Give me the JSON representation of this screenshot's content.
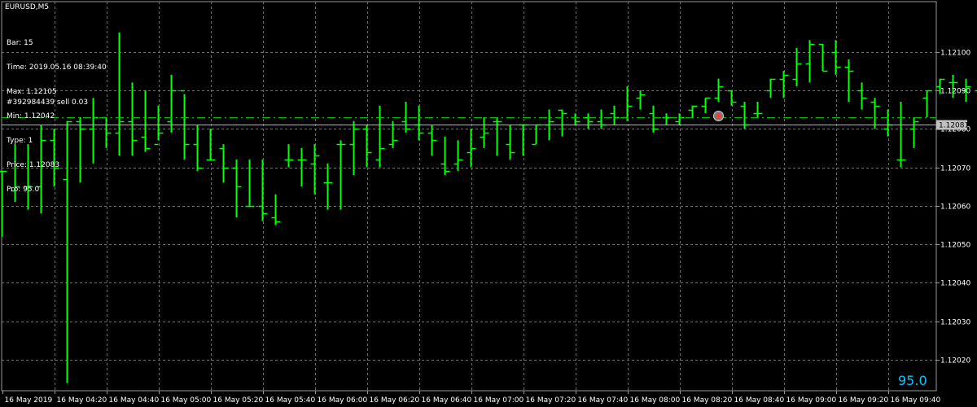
{
  "symbol_tf": "EURUSD,M5",
  "info_lines": [
    "Bar: 15",
    "Time: 2019.05.16 08:39:40",
    "Max: 1.12105",
    "Min: 1.12042",
    "Type: 1",
    "Price: 1.12083",
    "Pro: 95.0"
  ],
  "order_label": "#392984439 sell 0.03",
  "current_price_label": "1.12081",
  "big_value": "95.0",
  "colors": {
    "bars": "#00ff00",
    "grid": "#6f6f6f",
    "price_tag": "#c0c0c0",
    "big_value": "#00c8ff"
  },
  "chart_data": {
    "type": "ohlc",
    "xlabel": "",
    "ylabel": "",
    "ylim": [
      1.12012,
      1.12113
    ],
    "grid": true,
    "y_ticks": [
      "1.12100",
      "1.12090",
      "1.12080",
      "1.12070",
      "1.12060",
      "1.12050",
      "1.12040",
      "1.12030",
      "1.12020"
    ],
    "x_ticks": [
      "16 May 2019",
      "16 May 04:20",
      "16 May 04:40",
      "16 May 05:00",
      "16 May 05:20",
      "16 May 05:40",
      "16 May 06:00",
      "16 May 06:20",
      "16 May 06:40",
      "16 May 07:00",
      "16 May 07:20",
      "16 May 07:40",
      "16 May 08:00",
      "16 May 08:20",
      "16 May 08:40",
      "16 May 09:00",
      "16 May 09:20",
      "16 May 09:40"
    ],
    "order_price": 1.12083,
    "current_price": 1.12081,
    "bars": [
      {
        "h": 1.12069,
        "l": 1.12052,
        "o": 1.12069,
        "c": 1.12069
      },
      {
        "h": 1.12076,
        "l": 1.12061,
        "o": 1.12064,
        "c": 1.12065
      },
      {
        "h": 1.12076,
        "l": 1.12059,
        "o": 1.12065,
        "c": 1.12065
      },
      {
        "h": 1.12081,
        "l": 1.12058,
        "o": 1.12065,
        "c": 1.12077
      },
      {
        "h": 1.1208,
        "l": 1.12065,
        "o": 1.12077,
        "c": 1.1207
      },
      {
        "h": 1.12082,
        "l": 1.12014,
        "o": 1.12067,
        "c": 1.12082
      },
      {
        "h": 1.12083,
        "l": 1.12066,
        "o": 1.12082,
        "c": 1.1208
      },
      {
        "h": 1.12088,
        "l": 1.12071,
        "o": 1.1208,
        "c": 1.12083
      },
      {
        "h": 1.12083,
        "l": 1.12075,
        "o": 1.12083,
        "c": 1.12079
      },
      {
        "h": 1.12105,
        "l": 1.12073,
        "o": 1.12079,
        "c": 1.12082
      },
      {
        "h": 1.12092,
        "l": 1.12073,
        "o": 1.12082,
        "c": 1.12077
      },
      {
        "h": 1.1209,
        "l": 1.12074,
        "o": 1.12078,
        "c": 1.12075
      },
      {
        "h": 1.12086,
        "l": 1.12077,
        "o": 1.12076,
        "c": 1.12079
      },
      {
        "h": 1.12094,
        "l": 1.12079,
        "o": 1.12082,
        "c": 1.1209
      },
      {
        "h": 1.12089,
        "l": 1.12072,
        "o": 1.1209,
        "c": 1.12076
      },
      {
        "h": 1.12081,
        "l": 1.12069,
        "o": 1.12076,
        "c": 1.1207
      },
      {
        "h": 1.1208,
        "l": 1.12072,
        "o": 1.12072,
        "c": 1.12072
      },
      {
        "h": 1.12076,
        "l": 1.12066,
        "o": 1.12075,
        "c": 1.1207
      },
      {
        "h": 1.12072,
        "l": 1.12057,
        "o": 1.1207,
        "c": 1.12065
      },
      {
        "h": 1.12072,
        "l": 1.1206,
        "o": 1.1206,
        "c": 1.1206
      },
      {
        "h": 1.12072,
        "l": 1.12056,
        "o": 1.1206,
        "c": 1.12058
      },
      {
        "h": 1.12063,
        "l": 1.12055,
        "o": 1.12057,
        "c": 1.12056
      },
      {
        "h": 1.12076,
        "l": 1.1207,
        "o": 1.12072,
        "c": 1.12072
      },
      {
        "h": 1.12075,
        "l": 1.12065,
        "o": 1.12072,
        "c": 1.12072
      },
      {
        "h": 1.12076,
        "l": 1.12063,
        "o": 1.12071,
        "c": 1.12073
      },
      {
        "h": 1.12071,
        "l": 1.12059,
        "o": 1.12066,
        "c": 1.12066
      },
      {
        "h": 1.12077,
        "l": 1.12059,
        "o": 1.12076,
        "c": 1.12076
      },
      {
        "h": 1.12082,
        "l": 1.12068,
        "o": 1.12076,
        "c": 1.1208
      },
      {
        "h": 1.12081,
        "l": 1.1207,
        "o": 1.1208,
        "c": 1.12074
      },
      {
        "h": 1.12086,
        "l": 1.1207,
        "o": 1.12072,
        "c": 1.12075
      },
      {
        "h": 1.12082,
        "l": 1.12075,
        "o": 1.12076,
        "c": 1.12077
      },
      {
        "h": 1.12087,
        "l": 1.12079,
        "o": 1.12082,
        "c": 1.1208
      },
      {
        "h": 1.12086,
        "l": 1.12077,
        "o": 1.12081,
        "c": 1.12079
      },
      {
        "h": 1.12081,
        "l": 1.12073,
        "o": 1.12079,
        "c": 1.12077
      },
      {
        "h": 1.12078,
        "l": 1.12068,
        "o": 1.12071,
        "c": 1.12069
      },
      {
        "h": 1.12077,
        "l": 1.12069,
        "o": 1.12071,
        "c": 1.12072
      },
      {
        "h": 1.1208,
        "l": 1.1207,
        "o": 1.12074,
        "c": 1.12075
      },
      {
        "h": 1.12083,
        "l": 1.12075,
        "o": 1.12078,
        "c": 1.12079
      },
      {
        "h": 1.12083,
        "l": 1.12073,
        "o": 1.12082,
        "c": 1.12082
      },
      {
        "h": 1.12081,
        "l": 1.12072,
        "o": 1.12076,
        "c": 1.12074
      },
      {
        "h": 1.12081,
        "l": 1.12073,
        "o": 1.12081,
        "c": 1.12081
      },
      {
        "h": 1.12081,
        "l": 1.12076,
        "o": 1.12076,
        "c": 1.12081
      },
      {
        "h": 1.12085,
        "l": 1.12077,
        "o": 1.12081,
        "c": 1.12082
      },
      {
        "h": 1.12085,
        "l": 1.12078,
        "o": 1.12085,
        "c": 1.12084
      },
      {
        "h": 1.12084,
        "l": 1.12081,
        "o": 1.12083,
        "c": 1.12082
      },
      {
        "h": 1.12084,
        "l": 1.1208,
        "o": 1.12083,
        "c": 1.12082
      },
      {
        "h": 1.12085,
        "l": 1.1208,
        "o": 1.12082,
        "c": 1.12081
      },
      {
        "h": 1.12086,
        "l": 1.12081,
        "o": 1.12084,
        "c": 1.12083
      },
      {
        "h": 1.12091,
        "l": 1.12082,
        "o": 1.12083,
        "c": 1.12086
      },
      {
        "h": 1.1209,
        "l": 1.12085,
        "o": 1.12088,
        "c": 1.12089
      },
      {
        "h": 1.12086,
        "l": 1.12079,
        "o": 1.12084,
        "c": 1.1208
      },
      {
        "h": 1.12084,
        "l": 1.12081,
        "o": 1.12083,
        "c": 1.12083
      },
      {
        "h": 1.12084,
        "l": 1.12081,
        "o": 1.12082,
        "c": 1.12083
      },
      {
        "h": 1.12086,
        "l": 1.12083,
        "o": 1.12085,
        "c": 1.12086
      },
      {
        "h": 1.12088,
        "l": 1.12084,
        "o": 1.12086,
        "c": 1.12088
      },
      {
        "h": 1.12093,
        "l": 1.12087,
        "o": 1.12088,
        "c": 1.12091
      },
      {
        "h": 1.1209,
        "l": 1.12086,
        "o": 1.1209,
        "c": 1.12087
      },
      {
        "h": 1.12087,
        "l": 1.1208,
        "o": 1.12086,
        "c": 1.12081
      },
      {
        "h": 1.12087,
        "l": 1.12083,
        "o": 1.12084,
        "c": 1.12084
      },
      {
        "h": 1.12093,
        "l": 1.12088,
        "o": 1.1209,
        "c": 1.12093
      },
      {
        "h": 1.12095,
        "l": 1.12088,
        "o": 1.12093,
        "c": 1.12094
      },
      {
        "h": 1.12101,
        "l": 1.12091,
        "o": 1.12093,
        "c": 1.12097
      },
      {
        "h": 1.12103,
        "l": 1.12092,
        "o": 1.12097,
        "c": 1.12102
      },
      {
        "h": 1.12102,
        "l": 1.12095,
        "o": 1.12102,
        "c": 1.12095
      },
      {
        "h": 1.12103,
        "l": 1.12094,
        "o": 1.121,
        "c": 1.12096
      },
      {
        "h": 1.12098,
        "l": 1.12087,
        "o": 1.12096,
        "c": 1.12095
      },
      {
        "h": 1.12092,
        "l": 1.12085,
        "o": 1.1209,
        "c": 1.12088
      },
      {
        "h": 1.12088,
        "l": 1.1208,
        "o": 1.12087,
        "c": 1.12086
      },
      {
        "h": 1.12085,
        "l": 1.12078,
        "o": 1.1208,
        "c": 1.12081
      },
      {
        "h": 1.12087,
        "l": 1.1207,
        "o": 1.12072,
        "c": 1.12072
      },
      {
        "h": 1.12083,
        "l": 1.12075,
        "o": 1.1208,
        "c": 1.12082
      },
      {
        "h": 1.1209,
        "l": 1.12083,
        "o": 1.12088,
        "c": 1.1209
      },
      {
        "h": 1.12093,
        "l": 1.12089,
        "o": 1.12091,
        "c": 1.12093
      },
      {
        "h": 1.12094,
        "l": 1.12088,
        "o": 1.12092,
        "c": 1.12092
      },
      {
        "h": 1.12093,
        "l": 1.12087,
        "o": 1.1209,
        "c": 1.12091
      },
      {
        "h": 1.12093,
        "l": 1.12086,
        "o": 1.1209,
        "c": 1.1209
      },
      {
        "h": 1.12094,
        "l": 1.12077,
        "o": 1.1209,
        "c": 1.12077
      },
      {
        "h": 1.12082,
        "l": 1.12076,
        "o": 1.12079,
        "c": 1.12078
      },
      {
        "h": 1.12085,
        "l": 1.12078,
        "o": 1.1208,
        "c": 1.1208
      },
      {
        "h": 1.12111,
        "l": 1.1208,
        "o": 1.1208,
        "c": 1.12111
      },
      {
        "h": 1.12111,
        "l": 1.12043,
        "o": 1.12111,
        "c": 1.12066
      },
      {
        "h": 1.12069,
        "l": 1.12061,
        "o": 1.12066,
        "c": 1.12068
      },
      {
        "h": 1.12069,
        "l": 1.12047,
        "o": 1.12068,
        "c": 1.12049
      },
      {
        "h": 1.12057,
        "l": 1.12043,
        "o": 1.12049,
        "c": 1.1205
      },
      {
        "h": 1.12066,
        "l": 1.12061,
        "o": 1.12062,
        "c": 1.12066
      },
      {
        "h": 1.12083,
        "l": 1.12062,
        "o": 1.12063,
        "c": 1.1208
      },
      {
        "h": 1.12085,
        "l": 1.1207,
        "o": 1.1208,
        "c": 1.12081
      },
      {
        "h": 1.12097,
        "l": 1.12078,
        "o": 1.12078,
        "c": 1.12095
      },
      {
        "h": 1.12098,
        "l": 1.1208,
        "o": 1.12095,
        "c": 1.12081
      },
      {
        "h": 1.12084,
        "l": 1.1208,
        "o": 1.12081,
        "c": 1.12081
      }
    ]
  }
}
